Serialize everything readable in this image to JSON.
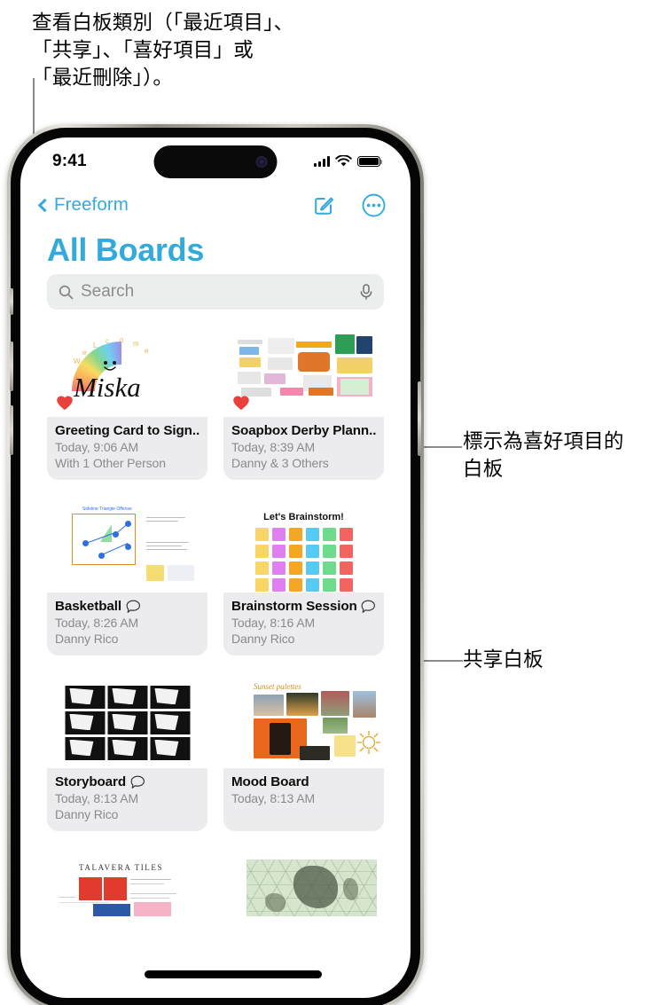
{
  "annotations": {
    "top": "查看白板類別（「最近項目」、\n「共享」、「喜好項目」或\n「最近刪除」）。",
    "favorite": "標示為喜好項目的\n白板",
    "shared": "共享白板"
  },
  "status_bar": {
    "time": "9:41",
    "cellular_icon": "signal-bars-icon",
    "wifi_icon": "wifi-icon",
    "battery_icon": "battery-icon"
  },
  "nav_bar": {
    "back_label": "Freeform",
    "back_icon": "chevron-left-icon",
    "compose_icon": "compose-icon",
    "more_icon": "more-circle-icon"
  },
  "header": {
    "title": "All Boards",
    "accent_color": "#34aadc"
  },
  "search": {
    "placeholder": "Search",
    "value": "",
    "search_icon": "search-icon",
    "mic_icon": "microphone-icon"
  },
  "boards": [
    {
      "title": "Greeting Card to Sign...",
      "date": "Today, 9:06 AM",
      "participants": "With 1 Other Person",
      "favorite": true,
      "shared": false,
      "thumb": "greeting-card-thumbnail"
    },
    {
      "title": "Soapbox Derby Plann...",
      "date": "Today, 8:39 AM",
      "participants": "Danny & 3 Others",
      "favorite": true,
      "shared": false,
      "thumb": "soapbox-derby-thumbnail"
    },
    {
      "title": "Basketball",
      "date": "Today, 8:26 AM",
      "participants": "Danny Rico",
      "favorite": false,
      "shared": true,
      "thumb": "basketball-thumbnail"
    },
    {
      "title": "Brainstorm Session",
      "date": "Today, 8:16 AM",
      "participants": "Danny Rico",
      "favorite": false,
      "shared": true,
      "thumb": "brainstorm-thumbnail",
      "thumb_text": "Let's Brainstorm!"
    },
    {
      "title": "Storyboard",
      "date": "Today, 8:13 AM",
      "participants": "Danny Rico",
      "favorite": false,
      "shared": true,
      "thumb": "storyboard-thumbnail"
    },
    {
      "title": "Mood Board",
      "date": "Today, 8:13 AM",
      "participants": "",
      "favorite": false,
      "shared": false,
      "thumb": "mood-board-thumbnail",
      "thumb_text": "Sunset palettes"
    }
  ],
  "boards_partial": [
    {
      "thumb": "talavera-tiles-thumbnail",
      "thumb_text": "TALAVERA TILES"
    },
    {
      "thumb": "map-thumbnail",
      "thumb_text": ""
    }
  ],
  "colors": {
    "accent": "#34aadc",
    "heart": "#e8413c",
    "card_bg": "#ececee",
    "search_bg": "#eceded",
    "subtitle": "#8a8a8e"
  }
}
